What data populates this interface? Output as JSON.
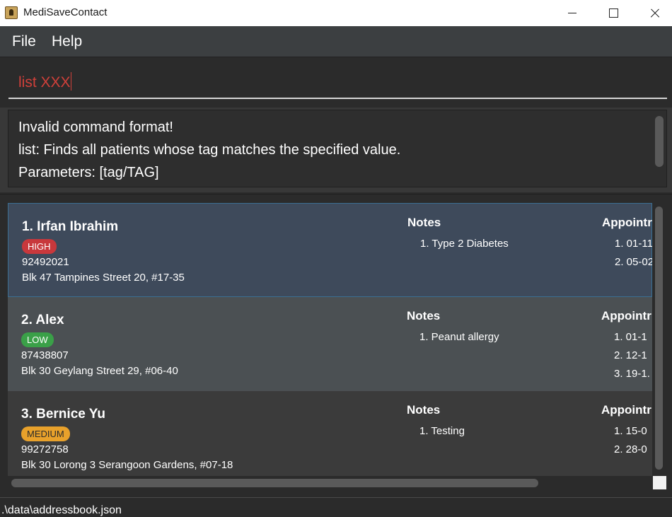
{
  "window": {
    "title": "MediSaveContact",
    "icon": "app-icon"
  },
  "menu": {
    "file_label": "File",
    "help_label": "Help"
  },
  "command": {
    "value": "list XXX",
    "text_color": "#d0403a"
  },
  "result": {
    "lines": [
      "Invalid command format!",
      "list: Finds all patients whose tag matches the specified value.",
      "Parameters: [tag/TAG]"
    ]
  },
  "patients": [
    {
      "index_name": "1.  Irfan Ibrahim",
      "tag": "HIGH",
      "tag_color": "#c8383c",
      "phone": "92492021",
      "address": "Blk 47 Tampines Street 20, #17-35",
      "notes_heading": "Notes",
      "notes": [
        "1.  Type 2 Diabetes"
      ],
      "appointments_heading": "Appointr",
      "appointments": [
        "1.  01-11",
        "2.  05-02"
      ],
      "selected": true
    },
    {
      "index_name": "2.  Alex",
      "tag": "LOW",
      "tag_color": "#3aa048",
      "phone": "87438807",
      "address": "Blk 30 Geylang Street 29, #06-40",
      "notes_heading": "Notes",
      "notes": [
        "1.  Peanut allergy"
      ],
      "appointments_heading": "Appointr",
      "appointments": [
        "1.  01-1",
        "2.  12-1",
        "3.  19-1."
      ]
    },
    {
      "index_name": "3.  Bernice Yu",
      "tag": "MEDIUM",
      "tag_color": "#e8a12b",
      "phone": "99272758",
      "address": "Blk 30 Lorong 3 Serangoon Gardens, #07-18",
      "notes_heading": "Notes",
      "notes": [
        "1.  Testing"
      ],
      "appointments_heading": "Appointr",
      "appointments": [
        "1.  15-0",
        "2.  28-0"
      ]
    }
  ],
  "status": {
    "file_path": ".\\data\\addressbook.json"
  }
}
